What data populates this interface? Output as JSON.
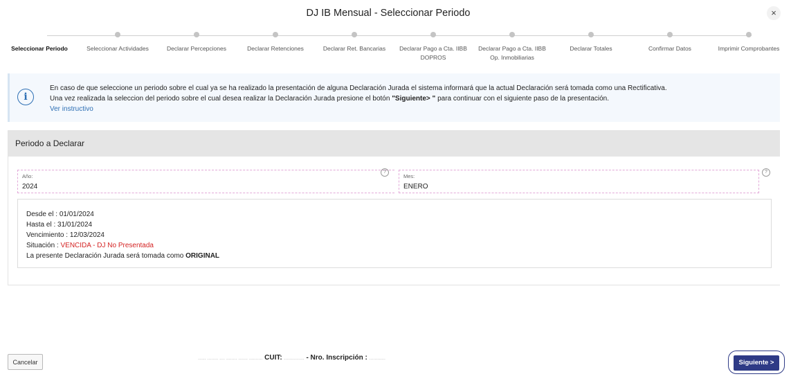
{
  "dialog": {
    "title": "DJ IB Mensual - Seleccionar Periodo",
    "close_symbol": "×"
  },
  "steps": [
    {
      "label": "Seleccionar Periodo",
      "active": true
    },
    {
      "label": "Seleccionar Actividades"
    },
    {
      "label": "Declarar Percepciones"
    },
    {
      "label": "Declarar Retenciones"
    },
    {
      "label": "Declarar Ret. Bancarias"
    },
    {
      "label": "Declarar Pago a Cta. IIBB DOPROS"
    },
    {
      "label": "Declarar Pago a Cta. IIBB Op. Inmobiliarias"
    },
    {
      "label": "Declarar Totales"
    },
    {
      "label": "Confirmar Datos"
    },
    {
      "label": "Imprimir Comprobantes"
    }
  ],
  "info": {
    "icon": "info-circle-icon",
    "line1": "En caso de que seleccione un periodo sobre el cual ya se ha realizado la presentación de alguna Declaración Jurada el sistema informará que la actual Declaración será tomada como una Rectificativa.",
    "line2_prefix": "Una vez realizada la seleccion del periodo sobre el cual desea realizar la Declaración Jurada presione el botón ",
    "line2_bold": "\"Siguiente> \"",
    "line2_suffix": " para continuar con el siguiente paso de la presentación.",
    "link": "Ver instructivo"
  },
  "periodo": {
    "header": "Periodo a Declarar",
    "year_label": "Año:",
    "year_value": "2024",
    "month_label": "Mes:",
    "month_value": "ENERO",
    "help_symbol": "?",
    "desde_label": "Desde el :",
    "desde_value": "01/01/2024",
    "hasta_label": "Hasta el :",
    "hasta_value": "31/01/2024",
    "venc_label": "Vencimiento :",
    "venc_value": "12/03/2024",
    "situacion_label": "Situación :",
    "situacion_value": "VENCIDA - DJ No Presentada",
    "dj_text": "La presente Declaración Jurada será tomada como ",
    "dj_type": "ORIGINAL"
  },
  "footer": {
    "cancel": "Cancelar",
    "name_blurred": "...... ........ .... ........ ....... ..........",
    "cuit_label": "CUIT:",
    "cuit_value": "...............",
    "nro_label": "- Nro. Inscripción :",
    "nro_value": "............",
    "next": "Siguiente >"
  },
  "colors": {
    "accent": "#2e3a86",
    "info_icon": "#2d6fb4",
    "alert": "#d42222"
  }
}
